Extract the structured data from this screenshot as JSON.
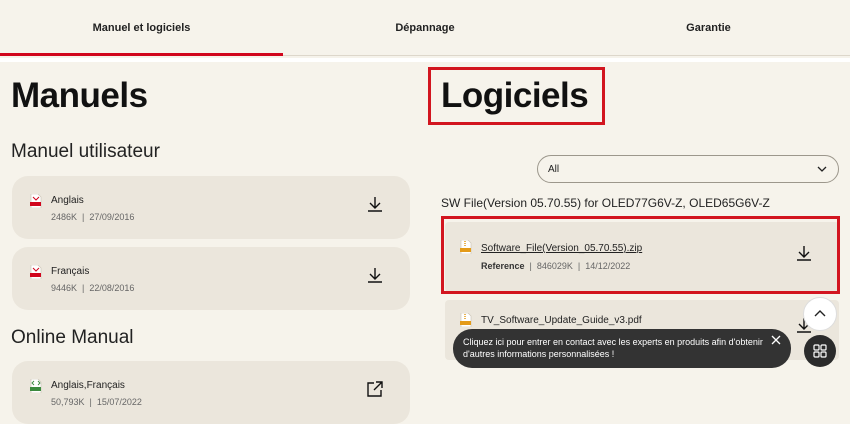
{
  "tabs": [
    {
      "label": "Manuel et logiciels"
    },
    {
      "label": "Dépannage"
    },
    {
      "label": "Garantie"
    }
  ],
  "manuals": {
    "title": "Manuels",
    "user_manual_title": "Manuel utilisateur",
    "items": [
      {
        "name": "Anglais",
        "size": "2486K",
        "date": "27/09/2016",
        "icon": "pdf-icon"
      },
      {
        "name": "Français",
        "size": "9446K",
        "date": "22/08/2016",
        "icon": "pdf-icon"
      }
    ],
    "online_title": "Online Manual",
    "online_items": [
      {
        "name": "Anglais,Français",
        "size": "50,793K",
        "date": "15/07/2022",
        "icon": "html-icon"
      }
    ]
  },
  "software": {
    "title": "Logiciels",
    "filter_value": "All",
    "group_title": "SW File(Version 05.70.55) for OLED77G6V-Z, OLED65G6V-Z",
    "items": [
      {
        "name": "Software_File(Version_05.70.55).zip",
        "ref_label": "Reference",
        "size": "846029K",
        "date": "14/12/2022",
        "icon": "zip-icon"
      },
      {
        "name": "TV_Software_Update_Guide_v3.pdf",
        "icon": "zip-icon"
      }
    ]
  },
  "toast": {
    "message": "Cliquez ici pour entrer en contact avec les experts en produits afin d'obtenir d'autres informations personnalisées !"
  },
  "colors": {
    "accent": "#d1051c",
    "highlight": "#d2151f",
    "background": "#f6f3eb",
    "card": "#ebe6dc"
  }
}
